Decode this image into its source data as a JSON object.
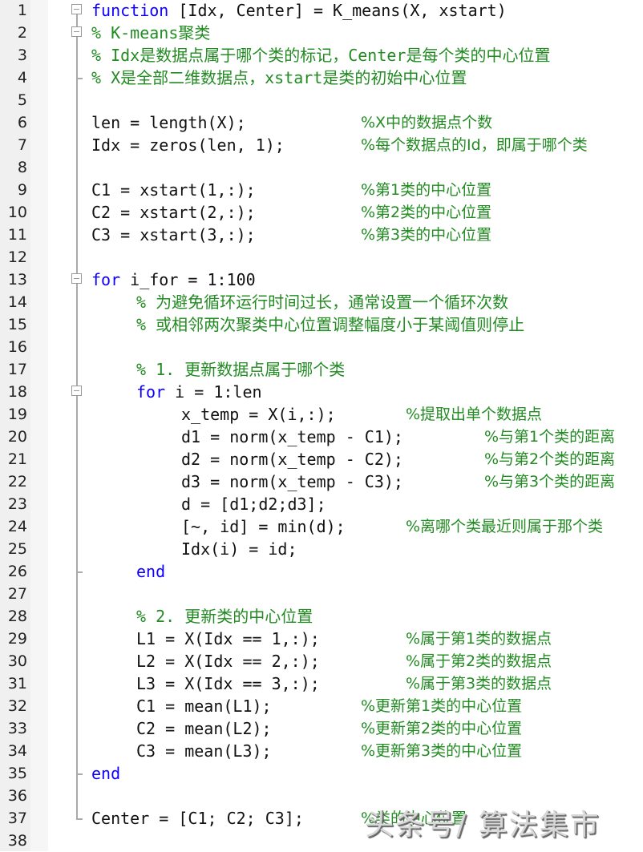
{
  "editor": {
    "language": "MATLAB",
    "colors": {
      "keyword": "#0e00ff",
      "comment": "#228b22",
      "text": "#111111"
    },
    "lines": [
      {
        "n": "1",
        "indent": 0,
        "tokens": [
          [
            "kw",
            "function"
          ],
          [
            "t",
            " [Idx, Center] = K_means(X, xstart)"
          ]
        ],
        "comment": ""
      },
      {
        "n": "2",
        "indent": 0,
        "tokens": [
          [
            "c",
            "% K-means聚类"
          ]
        ],
        "comment": ""
      },
      {
        "n": "3",
        "indent": 0,
        "tokens": [
          [
            "c",
            "% Idx是数据点属于哪个类的标记，Center是每个类的中心位置"
          ]
        ],
        "comment": ""
      },
      {
        "n": "4",
        "indent": 0,
        "tokens": [
          [
            "c",
            "% X是全部二维数据点，xstart是类的初始中心位置"
          ]
        ],
        "comment": ""
      },
      {
        "n": "5",
        "indent": 0,
        "tokens": [],
        "comment": ""
      },
      {
        "n": "6",
        "indent": 0,
        "tokens": [
          [
            "t",
            "len = length(X);"
          ]
        ],
        "comment": "%X中的数据点个数"
      },
      {
        "n": "7",
        "indent": 0,
        "tokens": [
          [
            "t",
            "Idx = zeros(len, 1);"
          ]
        ],
        "comment": "%每个数据点的Id，即属于哪个类"
      },
      {
        "n": "8",
        "indent": 0,
        "tokens": [],
        "comment": ""
      },
      {
        "n": "9",
        "indent": 0,
        "tokens": [
          [
            "t",
            "C1 = xstart(1,:);"
          ]
        ],
        "comment": "%第1类的中心位置"
      },
      {
        "n": "10",
        "indent": 0,
        "tokens": [
          [
            "t",
            "C2 = xstart(2,:);"
          ]
        ],
        "comment": "%第2类的中心位置"
      },
      {
        "n": "11",
        "indent": 0,
        "tokens": [
          [
            "t",
            "C3 = xstart(3,:);"
          ]
        ],
        "comment": "%第3类的中心位置"
      },
      {
        "n": "12",
        "indent": 0,
        "tokens": [],
        "comment": ""
      },
      {
        "n": "13",
        "indent": 0,
        "tokens": [
          [
            "kw",
            "for"
          ],
          [
            "t",
            " i_for = 1:100"
          ]
        ],
        "comment": ""
      },
      {
        "n": "14",
        "indent": 1,
        "tokens": [
          [
            "c",
            "% 为避免循环运行时间过长，通常设置一个循环次数"
          ]
        ],
        "comment": ""
      },
      {
        "n": "15",
        "indent": 1,
        "tokens": [
          [
            "c",
            "% 或相邻两次聚类中心位置调整幅度小于某阈值则停止"
          ]
        ],
        "comment": ""
      },
      {
        "n": "16",
        "indent": 0,
        "tokens": [],
        "comment": ""
      },
      {
        "n": "17",
        "indent": 1,
        "tokens": [
          [
            "c",
            "% 1. 更新数据点属于哪个类"
          ]
        ],
        "comment": ""
      },
      {
        "n": "18",
        "indent": 1,
        "tokens": [
          [
            "kw",
            "for"
          ],
          [
            "t",
            " i = 1:len"
          ]
        ],
        "comment": ""
      },
      {
        "n": "19",
        "indent": 2,
        "tokens": [
          [
            "t",
            "x_temp = X(i,:);"
          ]
        ],
        "comment": "%提取出单个数据点"
      },
      {
        "n": "20",
        "indent": 2,
        "tokens": [
          [
            "t",
            "d1 = norm(x_temp - C1);"
          ]
        ],
        "comment": "%与第1个类的距离"
      },
      {
        "n": "21",
        "indent": 2,
        "tokens": [
          [
            "t",
            "d2 = norm(x_temp - C2);"
          ]
        ],
        "comment": "%与第2个类的距离"
      },
      {
        "n": "22",
        "indent": 2,
        "tokens": [
          [
            "t",
            "d3 = norm(x_temp - C3);"
          ]
        ],
        "comment": "%与第3个类的距离"
      },
      {
        "n": "23",
        "indent": 2,
        "tokens": [
          [
            "t",
            "d = [d1;d2;d3];"
          ]
        ],
        "comment": ""
      },
      {
        "n": "24",
        "indent": 2,
        "tokens": [
          [
            "t",
            "[~, id] = min(d);"
          ]
        ],
        "comment": "%离哪个类最近则属于那个类"
      },
      {
        "n": "25",
        "indent": 2,
        "tokens": [
          [
            "t",
            "Idx(i) = id;"
          ]
        ],
        "comment": ""
      },
      {
        "n": "26",
        "indent": 1,
        "tokens": [
          [
            "kw",
            "end"
          ]
        ],
        "comment": ""
      },
      {
        "n": "27",
        "indent": 0,
        "tokens": [],
        "comment": ""
      },
      {
        "n": "28",
        "indent": 1,
        "tokens": [
          [
            "c",
            "% 2. 更新类的中心位置"
          ]
        ],
        "comment": ""
      },
      {
        "n": "29",
        "indent": 1,
        "tokens": [
          [
            "t",
            "L1 = X(Idx == 1,:);"
          ]
        ],
        "comment": "%属于第1类的数据点"
      },
      {
        "n": "30",
        "indent": 1,
        "tokens": [
          [
            "t",
            "L2 = X(Idx == 2,:);"
          ]
        ],
        "comment": "%属于第2类的数据点"
      },
      {
        "n": "31",
        "indent": 1,
        "tokens": [
          [
            "t",
            "L3 = X(Idx == 3,:);"
          ]
        ],
        "comment": "%属于第3类的数据点"
      },
      {
        "n": "32",
        "indent": 1,
        "tokens": [
          [
            "t",
            "C1 = mean(L1);"
          ]
        ],
        "comment": "%更新第1类的中心位置"
      },
      {
        "n": "33",
        "indent": 1,
        "tokens": [
          [
            "t",
            "C2 = mean(L2);"
          ]
        ],
        "comment": "%更新第2类的中心位置"
      },
      {
        "n": "34",
        "indent": 1,
        "tokens": [
          [
            "t",
            "C3 = mean(L3);"
          ]
        ],
        "comment": "%更新第3类的中心位置"
      },
      {
        "n": "35",
        "indent": 0,
        "tokens": [
          [
            "kw",
            "end"
          ]
        ],
        "comment": ""
      },
      {
        "n": "36",
        "indent": 0,
        "tokens": [],
        "comment": ""
      },
      {
        "n": "37",
        "indent": 0,
        "tokens": [
          [
            "t",
            "Center = [C1; C2; C3];"
          ]
        ],
        "comment": "%类的中心位置"
      },
      {
        "n": "38",
        "indent": 0,
        "tokens": [],
        "comment": ""
      }
    ]
  },
  "watermark": {
    "text": "头条号/ 算法集市"
  }
}
